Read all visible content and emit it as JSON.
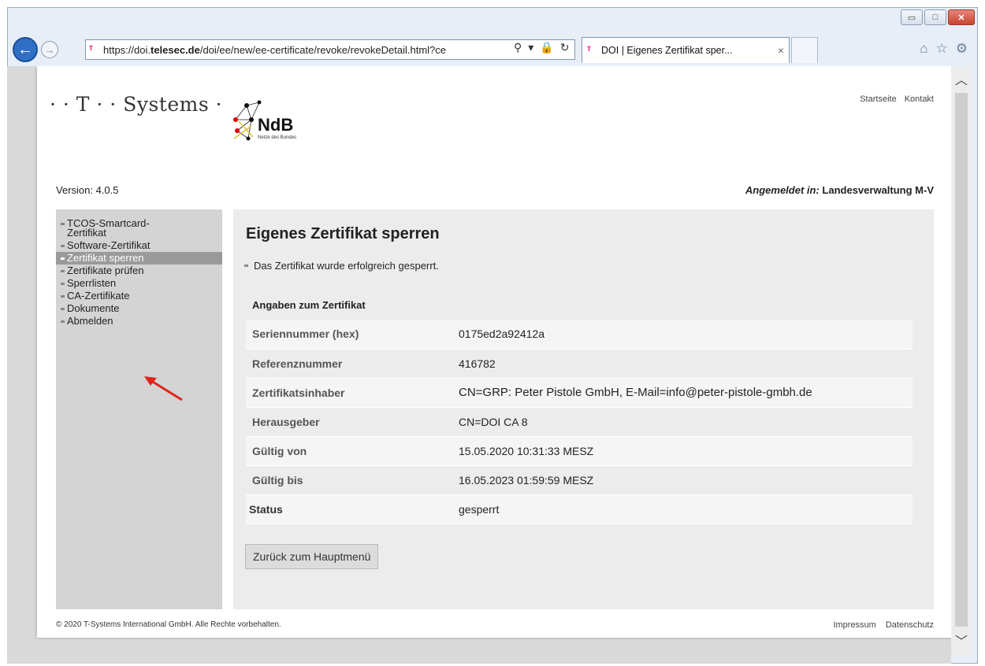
{
  "browser": {
    "address": {
      "url_prefix": "https://doi.",
      "url_domain": "telesec.de",
      "url_path": "/doi/ee/new/ee-certificate/revoke/revokeDetail.html?ce"
    },
    "tab": {
      "title": "DOI | Eigenes Zertifikat sper...",
      "close": "×"
    },
    "window_controls": {
      "minimize": "▭",
      "maximize": "□",
      "close": "✕"
    }
  },
  "header": {
    "logo_text": "· · T · · Systems ·",
    "ndb_text": "NdB",
    "ndb_sub": "Netze des Bundes",
    "top_links": [
      "Startseite",
      "Kontakt"
    ],
    "version": "Version: 4.0.5",
    "login_label": "Angemeldet in:",
    "login_value": "Landesverwaltung M-V"
  },
  "sidebar": {
    "items": [
      {
        "label": "TCOS-Smartcard-Zertifikat",
        "active": false
      },
      {
        "label": "Software-Zertifikat",
        "active": false
      },
      {
        "label": "Zertifikat sperren",
        "active": true
      },
      {
        "label": "Zertifikate prüfen",
        "active": false
      },
      {
        "label": "Sperrlisten",
        "active": false
      },
      {
        "label": "CA-Zertifikate",
        "active": false
      },
      {
        "label": "Dokumente",
        "active": false
      },
      {
        "label": "Abmelden",
        "active": false
      }
    ]
  },
  "main": {
    "title": "Eigenes Zertifikat sperren",
    "success_message": "Das Zertifikat wurde erfolgreich gesperrt.",
    "section_title": "Angaben zum Zertifikat",
    "details": [
      {
        "key": "Seriennummer (hex)",
        "value": "0175ed2a92412a"
      },
      {
        "key": "Referenznummer",
        "value": "416782"
      },
      {
        "key": "Zertifikatsinhaber",
        "value": "CN=GRP:  Peter Pistole GmbH, E-Mail=info@peter-pistole-gmbh.de"
      },
      {
        "key": "Herausgeber",
        "value": "CN=DOI CA 8"
      },
      {
        "key": "Gültig von",
        "value": "15.05.2020 10:31:33 MESZ"
      },
      {
        "key": "Gültig bis",
        "value": "16.05.2023 01:59:59 MESZ"
      },
      {
        "key": "Status",
        "value": "gesperrt"
      }
    ],
    "back_button": "Zurück zum Hauptmenü"
  },
  "footer": {
    "copyright": "© 2020 T-Systems International GmbH. Alle Rechte vorbehalten.",
    "links": [
      "Impressum",
      "Datenschutz"
    ]
  },
  "colors": {
    "brand": "#e20074",
    "active_nav": "#9a9a9a",
    "annotation_arrow": "#e0241b"
  }
}
